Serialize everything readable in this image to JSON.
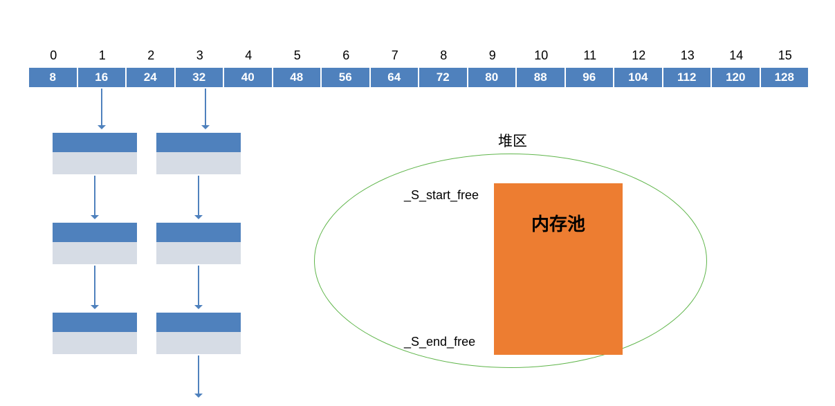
{
  "indices": [
    "0",
    "1",
    "2",
    "3",
    "4",
    "5",
    "6",
    "7",
    "8",
    "9",
    "10",
    "11",
    "12",
    "13",
    "14",
    "15"
  ],
  "buckets": [
    "8",
    "16",
    "24",
    "32",
    "40",
    "48",
    "56",
    "64",
    "72",
    "80",
    "88",
    "96",
    "104",
    "112",
    "120",
    "128"
  ],
  "heap": {
    "title": "堆区",
    "poolLabel": "内存池",
    "startPtr": "_S_start_free",
    "endPtr": "_S_end_free"
  }
}
